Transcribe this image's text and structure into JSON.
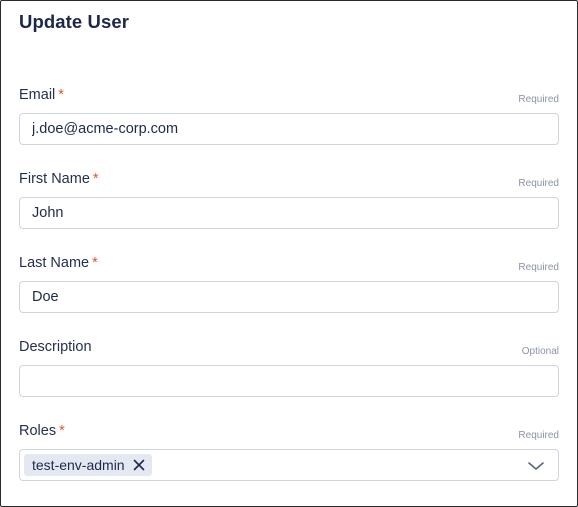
{
  "page": {
    "title": "Update User"
  },
  "form": {
    "email": {
      "label": "Email",
      "required_mark": "*",
      "hint": "Required",
      "value": "j.doe@acme-corp.com",
      "placeholder": ""
    },
    "first_name": {
      "label": "First Name",
      "required_mark": "*",
      "hint": "Required",
      "value": "John",
      "placeholder": ""
    },
    "last_name": {
      "label": "Last Name",
      "required_mark": "*",
      "hint": "Required",
      "value": "Doe",
      "placeholder": ""
    },
    "description": {
      "label": "Description",
      "hint": "Optional",
      "value": "",
      "placeholder": ""
    },
    "roles": {
      "label": "Roles",
      "required_mark": "*",
      "hint": "Required",
      "selected": [
        "test-env-admin"
      ],
      "chip_remove_icon": "close-icon",
      "dropdown_icon": "chevron-down-icon"
    }
  },
  "colors": {
    "required_star": "#e0552b",
    "title_text": "#1d2748",
    "input_border": "#cfd4de",
    "chip_background": "#e4e8f1",
    "hint_text": "#8a93a6"
  }
}
